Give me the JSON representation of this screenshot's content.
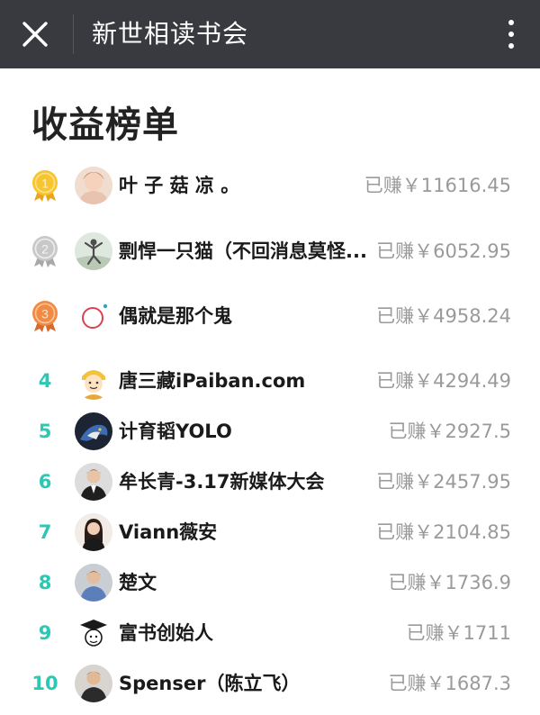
{
  "header": {
    "title": "新世相读书会",
    "close_icon": "close-icon",
    "more_icon": "more-vertical-icon",
    "background_color": "#393a3f"
  },
  "page": {
    "title": "收益榜单"
  },
  "leaderboard": {
    "earned_prefix": "已赚￥",
    "rank_color": "#2ec7b4",
    "entries": [
      {
        "rank": "1",
        "medal": "gold-medal-icon",
        "name": "叶 子 菇 凉 。",
        "amount": "11616.45",
        "earned_text": "已赚￥11616.45"
      },
      {
        "rank": "2",
        "medal": "silver-medal-icon",
        "name": "剽悍一只猫（不回消息莫怪...",
        "amount": "6052.95",
        "earned_text": "已赚￥6052.95"
      },
      {
        "rank": "3",
        "medal": "bronze-medal-icon",
        "name": "偶就是那个鬼",
        "amount": "4958.24",
        "earned_text": "已赚￥4958.24"
      },
      {
        "rank": "4",
        "name": "唐三藏iPaiban.com",
        "amount": "4294.49",
        "earned_text": "已赚￥4294.49"
      },
      {
        "rank": "5",
        "name": "计育韬YOLO",
        "amount": "2927.5",
        "earned_text": "已赚￥2927.5"
      },
      {
        "rank": "6",
        "name": "牟长青-3.17新媒体大会",
        "amount": "2457.95",
        "earned_text": "已赚￥2457.95"
      },
      {
        "rank": "7",
        "name": "Viann薇安",
        "amount": "2104.85",
        "earned_text": "已赚￥2104.85"
      },
      {
        "rank": "8",
        "name": "楚文",
        "amount": "1736.9",
        "earned_text": "已赚￥1736.9"
      },
      {
        "rank": "9",
        "name": "富书创始人",
        "amount": "1711",
        "earned_text": "已赚￥1711"
      },
      {
        "rank": "10",
        "name": "Spenser（陈立飞）",
        "amount": "1687.3",
        "earned_text": "已赚￥1687.3"
      }
    ]
  }
}
